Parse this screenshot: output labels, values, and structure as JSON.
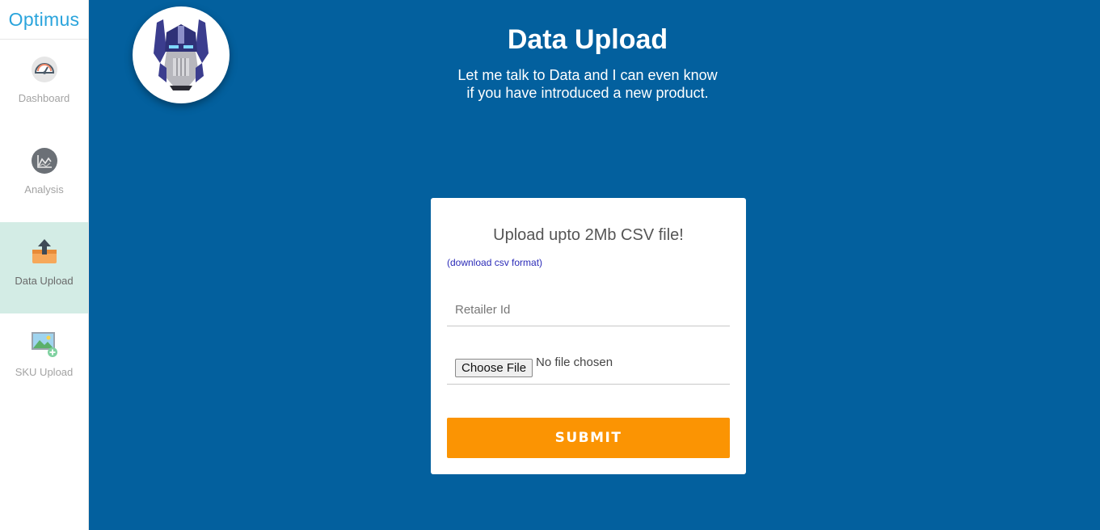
{
  "brand": "Optimus",
  "sidebar": {
    "items": [
      {
        "label": "Dashboard",
        "icon": "gauge-icon",
        "active": false
      },
      {
        "label": "Analysis",
        "icon": "chart-icon",
        "active": false
      },
      {
        "label": "Data Upload",
        "icon": "upload-icon",
        "active": true
      },
      {
        "label": "SKU Upload",
        "icon": "image-add-icon",
        "active": false
      }
    ]
  },
  "header": {
    "title": "Data Upload",
    "subtitle_line1": "Let me talk to Data and I can even know",
    "subtitle_line2": "if you have introduced a new product.",
    "avatar_icon": "robot-head-icon"
  },
  "upload_card": {
    "heading": "Upload upto 2Mb CSV file!",
    "download_link": "(download csv format)",
    "retailer_placeholder": "Retailer Id",
    "retailer_value": "",
    "choose_file_label": "Choose File",
    "file_status": "No file chosen",
    "submit_label": "SUBMIT"
  },
  "colors": {
    "background": "#03609e",
    "brand": "#2aa4dc",
    "active_nav_bg": "#d3ece5",
    "submit": "#fb9403",
    "link": "#2b2bb8"
  }
}
